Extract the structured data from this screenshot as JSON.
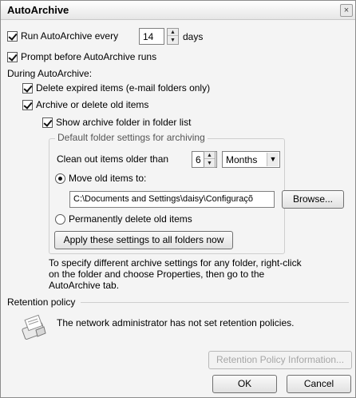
{
  "window": {
    "title": "AutoArchive",
    "close_glyph": "×"
  },
  "run_autoarchive": {
    "label_before": "Run AutoArchive every",
    "value": "14",
    "unit": "days",
    "checked": true
  },
  "prompt_before": {
    "label": "Prompt before AutoArchive runs",
    "checked": true
  },
  "during_label": "During AutoArchive:",
  "delete_expired": {
    "label": "Delete expired items (e-mail folders only)",
    "checked": true
  },
  "archive_old": {
    "label": "Archive or delete old items",
    "checked": true
  },
  "show_archive_folder": {
    "label": "Show archive folder in folder list",
    "checked": true
  },
  "default_group": {
    "title": "Default folder settings for archiving",
    "clean_out_label": "Clean out items older than",
    "clean_out_value": "6",
    "clean_out_unit": "Months",
    "move_label": "Move old items to:",
    "move_selected": true,
    "path": "C:\\Documents and Settings\\daisy\\Configuraçõ",
    "browse_label": "Browse...",
    "delete_label": "Permanently delete old items",
    "delete_selected": false,
    "apply_label": "Apply these settings to all folders now"
  },
  "info_text": {
    "line1": "To specify different archive settings for any folder, right-click",
    "line2": "on the folder and choose Properties, then go to the",
    "line3": "AutoArchive tab."
  },
  "retention": {
    "title": "Retention policy",
    "message": "The network administrator has not set retention policies.",
    "info_button": "Retention Policy Information...",
    "icon": "retention-policy-icon"
  },
  "footer": {
    "ok_label": "OK",
    "cancel_label": "Cancel"
  }
}
